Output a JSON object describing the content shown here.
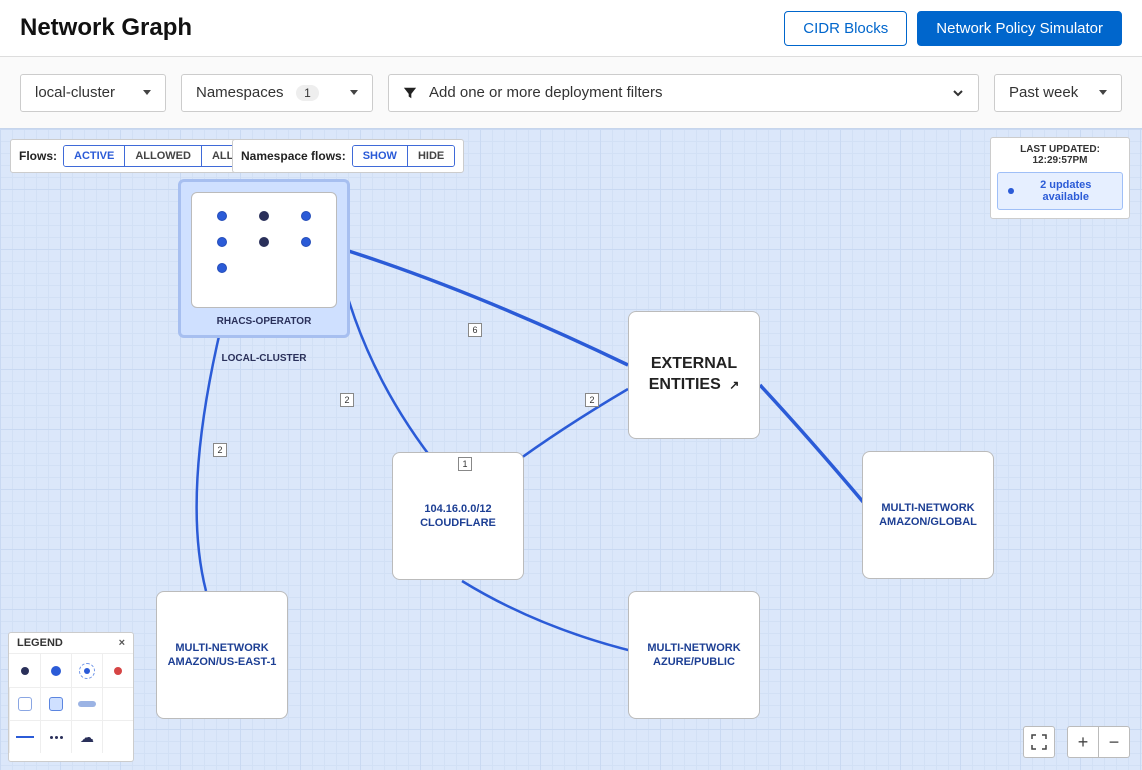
{
  "header": {
    "title": "Network Graph",
    "cidr_btn": "CIDR Blocks",
    "sim_btn": "Network Policy Simulator"
  },
  "toolbar": {
    "cluster_picker": "local-cluster",
    "namespaces_label": "Namespaces",
    "namespace_count": "1",
    "filter_placeholder": "Add one or more deployment filters",
    "time_picker": "Past week"
  },
  "flow_bar": {
    "label": "Flows:",
    "options": [
      "ACTIVE",
      "ALLOWED",
      "ALL"
    ],
    "active": "ACTIVE"
  },
  "ns_bar": {
    "label": "Namespace flows:",
    "options": [
      "SHOW",
      "HIDE"
    ],
    "active": "SHOW"
  },
  "updates": {
    "last_updated": "LAST UPDATED: 12:29:57PM",
    "pill": "2 updates available"
  },
  "graph": {
    "namespace": {
      "title": "RHACS-OPERATOR",
      "cluster_label": "LOCAL-CLUSTER",
      "pods": [
        {
          "kind": "blue"
        },
        {
          "kind": "dark"
        },
        {
          "kind": "blue"
        },
        {
          "kind": "blue"
        },
        {
          "kind": "dark"
        },
        {
          "kind": "blue"
        },
        {
          "kind": "blue"
        }
      ]
    },
    "nodes": {
      "external": {
        "line1": "EXTERNAL",
        "line2": "ENTITIES"
      },
      "cloudflare": {
        "line1": "104.16.0.0/12",
        "line2": "CLOUDFLARE"
      },
      "amz_global": {
        "line1": "MULTI-NETWORK",
        "line2": "AMAZON/GLOBAL"
      },
      "amz_east": {
        "line1": "MULTI-NETWORK",
        "line2": "AMAZON/US-EAST-1"
      },
      "azure": {
        "line1": "MULTI-NETWORK",
        "line2": "AZURE/PUBLIC"
      }
    },
    "edge_labels": {
      "ns_ext": "6",
      "ns_cloud": "2",
      "ext_cloud": "2",
      "ns_east": "2",
      "cloud_azure": "1"
    }
  },
  "legend": {
    "title": "LEGEND"
  },
  "controls": {
    "fullscreen": "⛶",
    "plus": "+",
    "minus": "−"
  }
}
